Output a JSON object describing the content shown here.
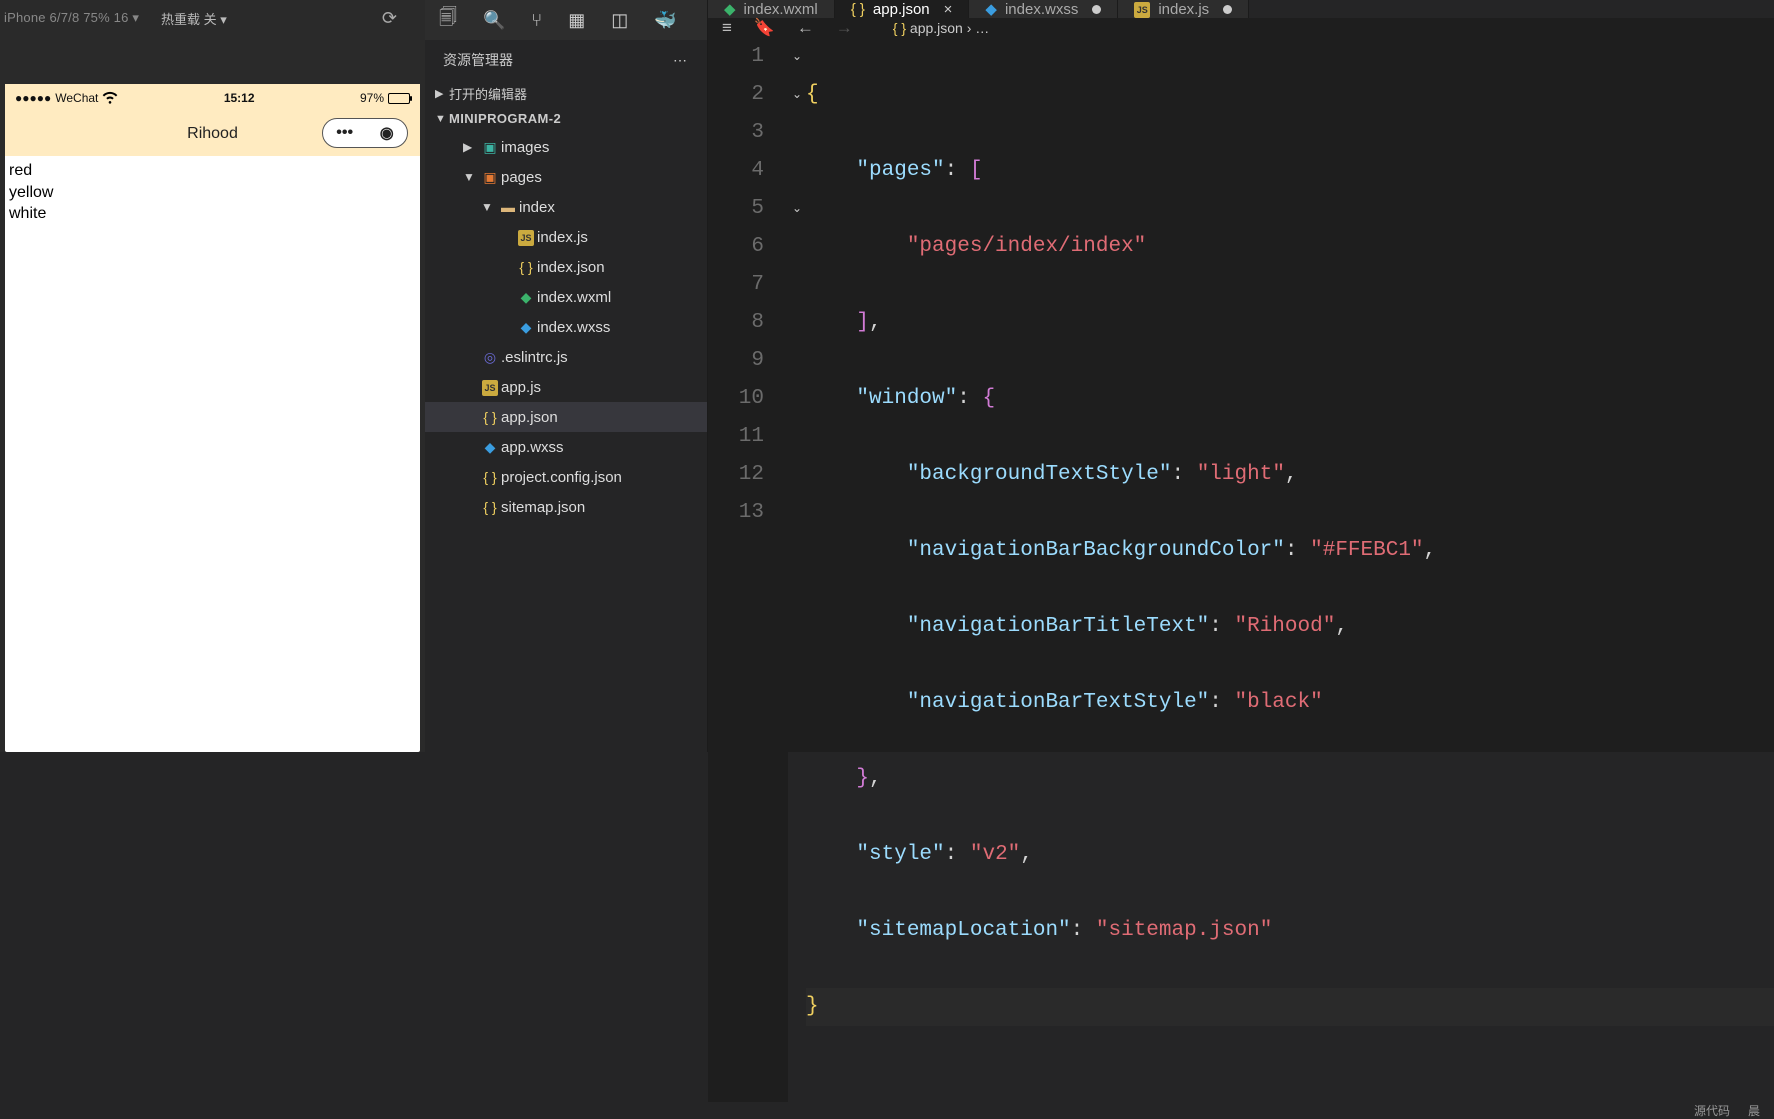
{
  "simulator": {
    "device_label": "iPhone 6/7/8 75% 16 ▾",
    "hot_reload": "热重载 关 ▾",
    "status": {
      "carrier": "WeChat",
      "time": "15:12",
      "battery": "97%"
    },
    "nav": {
      "title": "Rihood"
    },
    "body_lines": [
      "red",
      "yellow",
      "white"
    ]
  },
  "icon_strip": [
    "files",
    "search",
    "scm",
    "extensions",
    "layout",
    "docker"
  ],
  "explorer": {
    "title": "资源管理器",
    "sections": {
      "open_editors": "打开的编辑器",
      "project": "MINIPROGRAM-2"
    },
    "tree": {
      "images": "images",
      "pages": "pages",
      "index_folder": "index",
      "files_index": [
        "index.js",
        "index.json",
        "index.wxml",
        "index.wxss"
      ],
      "files_root": [
        ".eslintrc.js",
        "app.js",
        "app.json",
        "app.wxss",
        "project.config.json",
        "sitemap.json"
      ]
    },
    "selected": "app.json"
  },
  "tabs": [
    {
      "name": "index.wxml",
      "icon": "wxml",
      "active": false,
      "dirty": false
    },
    {
      "name": "app.json",
      "icon": "json",
      "active": true,
      "dirty": false
    },
    {
      "name": "index.wxss",
      "icon": "wxss",
      "active": false,
      "dirty": true
    },
    {
      "name": "index.js",
      "icon": "js",
      "active": false,
      "dirty": true
    }
  ],
  "breadcrumb": {
    "icons": [
      "list",
      "bookmark",
      "back",
      "forward"
    ],
    "path": "app.json › …",
    "icon_path_json": "{ }"
  },
  "code": {
    "lines": 13,
    "content": {
      "l2_key": "\"pages\"",
      "l3_str": "\"pages/index/index\"",
      "l5_key": "\"window\"",
      "l6_key": "\"backgroundTextStyle\"",
      "l6_val": "\"light\"",
      "l7_key": "\"navigationBarBackgroundColor\"",
      "l7_val": "\"#FFEBC1\"",
      "l8_key": "\"navigationBarTitleText\"",
      "l8_val": "\"Rihood\"",
      "l9_key": "\"navigationBarTextStyle\"",
      "l9_val": "\"black\"",
      "l11_key": "\"style\"",
      "l11_val": "\"v2\"",
      "l12_key": "\"sitemapLocation\"",
      "l12_val": "\"sitemap.json\""
    }
  },
  "status_bar": {
    "left": "源代码",
    "right": "晨"
  }
}
